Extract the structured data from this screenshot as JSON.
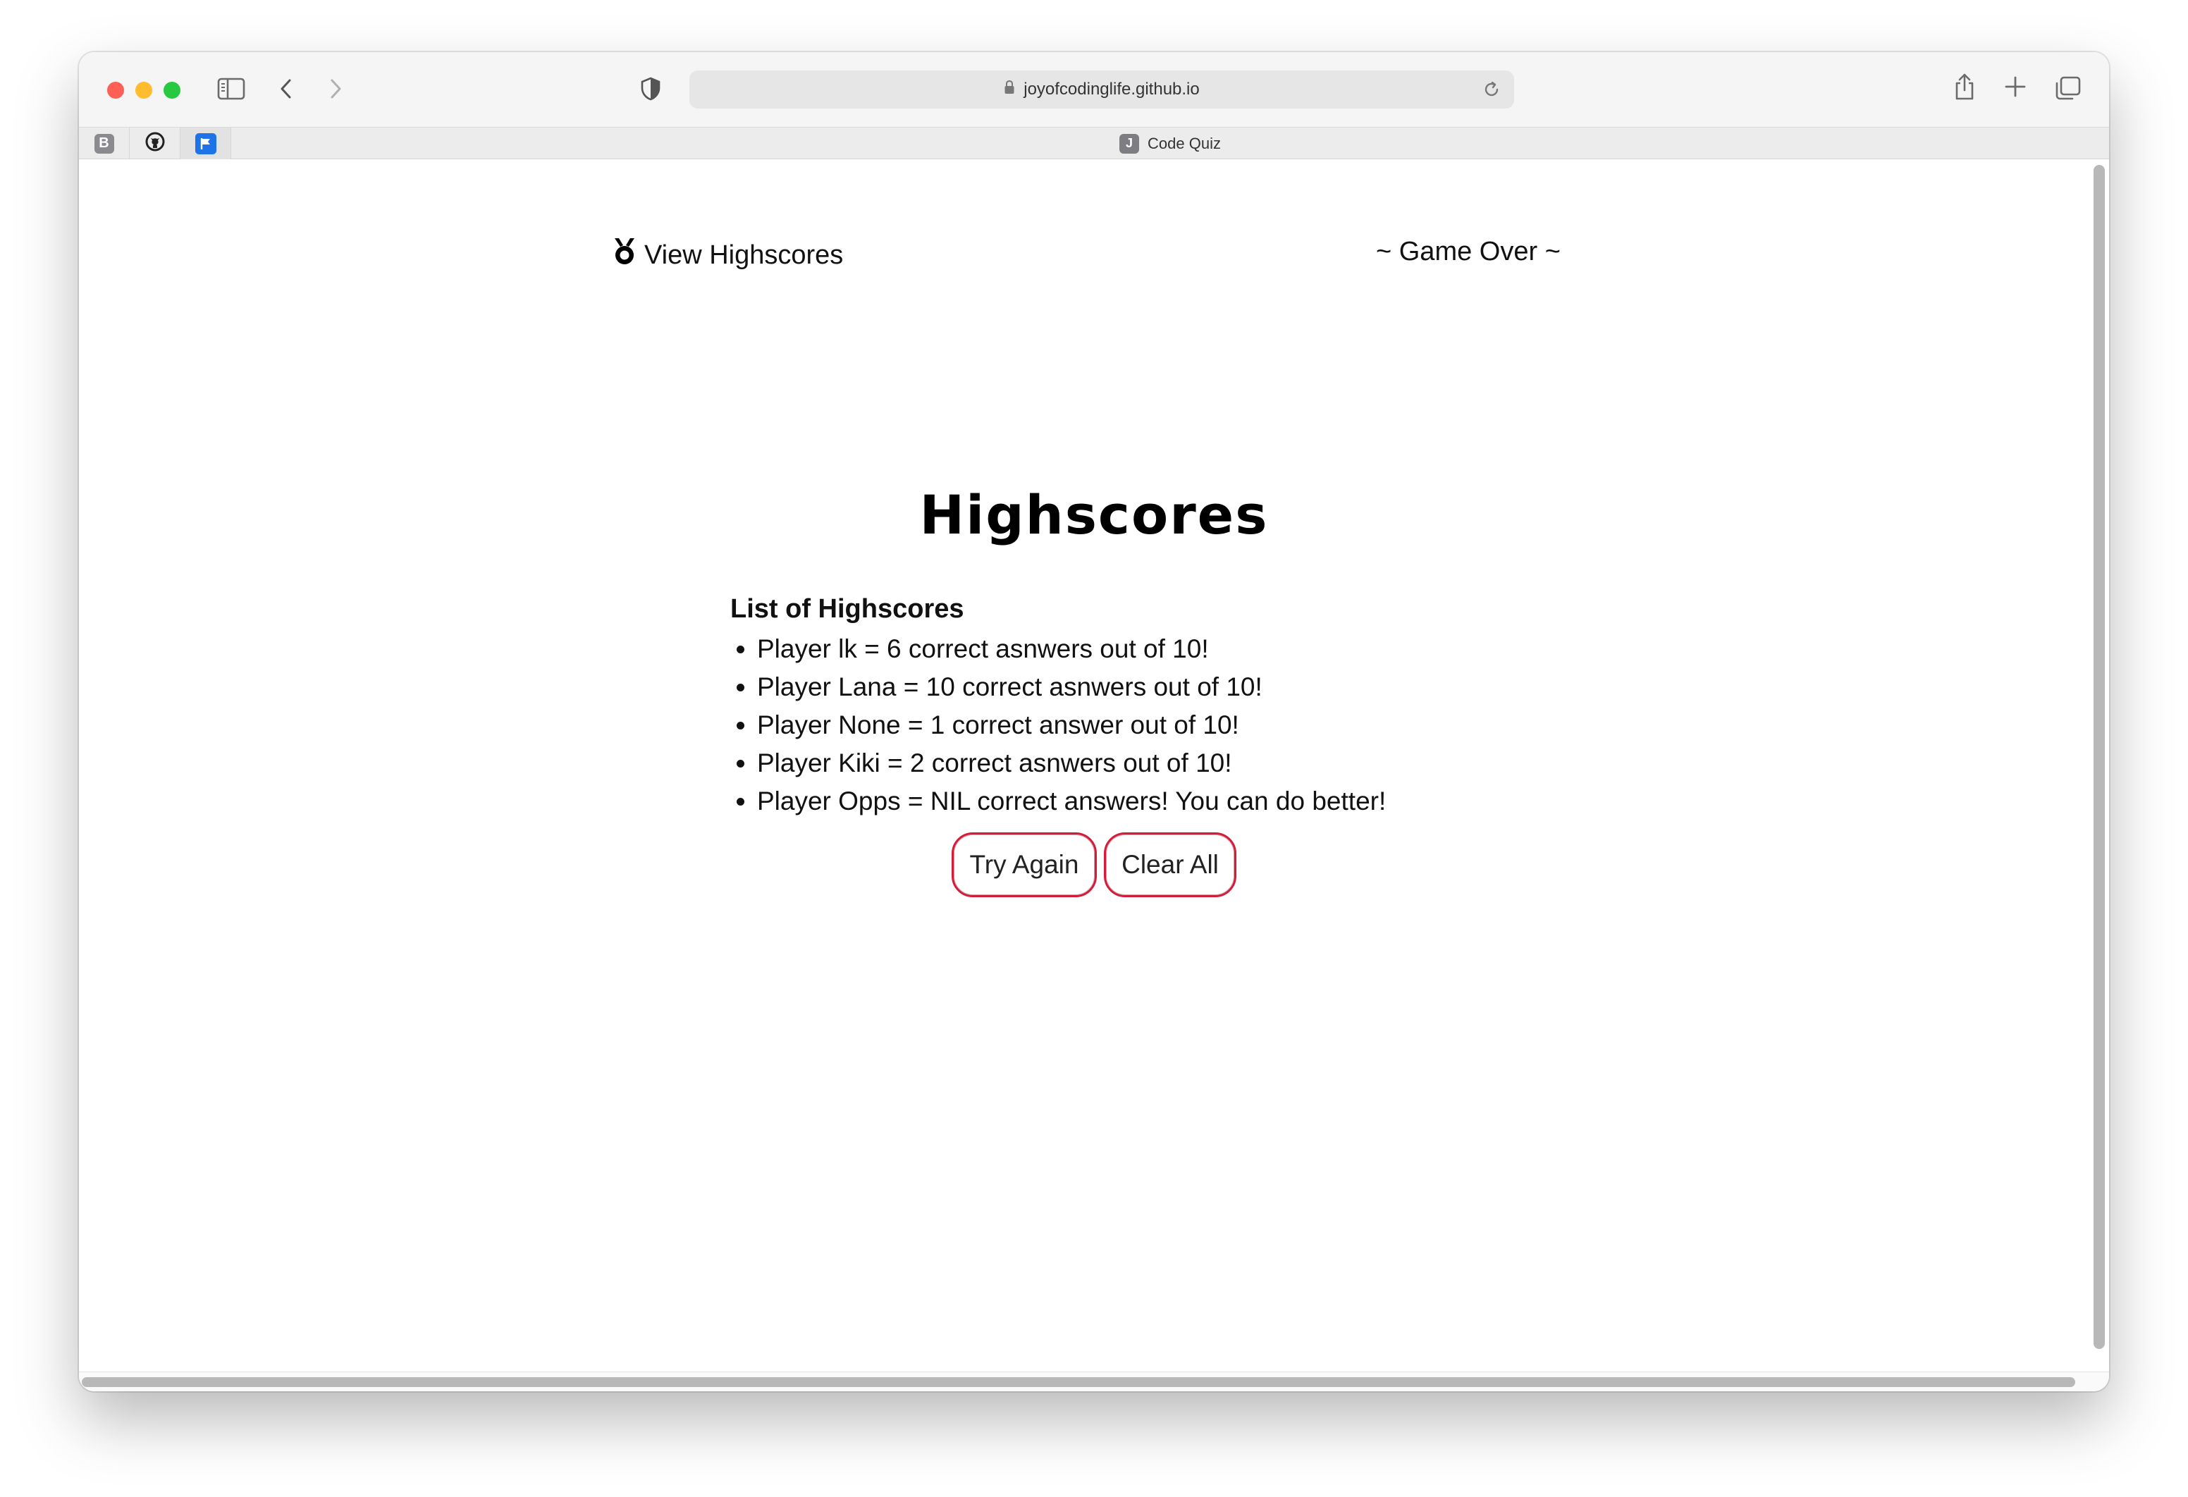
{
  "browser": {
    "url": "joyofcodinglife.github.io",
    "tab_title": "Code Quiz",
    "tab_favicon_letter": "J",
    "pinned_tabs": [
      "B",
      "github-icon",
      "flag-icon"
    ]
  },
  "header": {
    "view_highscores": "View Highscores",
    "status": "~ Game Over ~"
  },
  "main": {
    "title": "Highscores",
    "list_heading": "List of Highscores",
    "scores": [
      "Player lk = 6 correct asnwers out of 10!",
      "Player Lana = 10 correct asnwers out of 10!",
      "Player None = 1 correct answer out of 10!",
      "Player Kiki = 2 correct asnwers out of 10!",
      "Player Opps = NIL correct answers! You can do better!"
    ],
    "try_again_label": "Try Again",
    "clear_all_label": "Clear All"
  },
  "colors": {
    "button_border": "#d31b3a",
    "pinned_flag": "#1e73e8"
  }
}
